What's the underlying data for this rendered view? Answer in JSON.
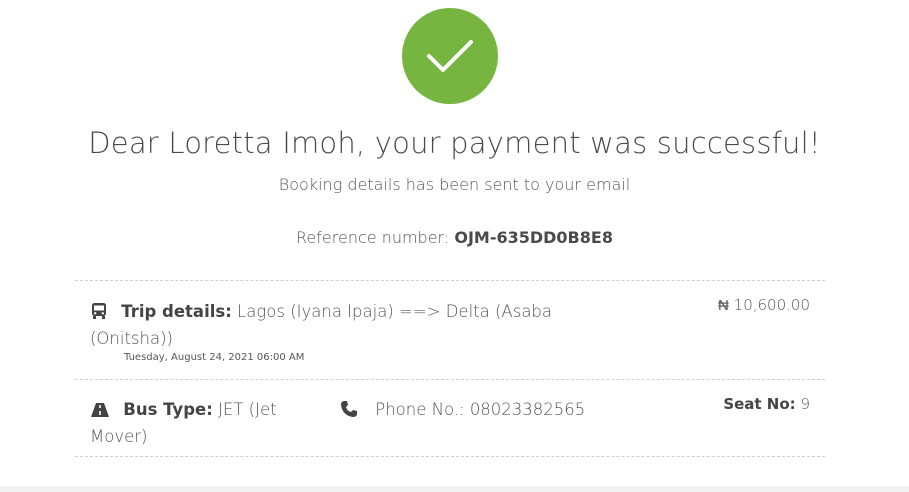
{
  "status": {
    "icon": "checkmark-icon",
    "color": "#77b541"
  },
  "headline": "Dear Loretta Imoh, your payment was successful!",
  "subline": "Booking details has been sent to your email",
  "reference": {
    "label": "Reference number:",
    "value": "OJM-635DD0B8E8"
  },
  "trip": {
    "icon": "bus-icon",
    "label": "Trip details:",
    "route": "Lagos (Iyana Ipaja) ==> Delta (Asaba (Onitsha))",
    "datetime": "Tuesday, August 24, 2021 06:00 AM",
    "price": "₦ 10,600.00"
  },
  "bus": {
    "icon": "road-icon",
    "label": "Bus Type:",
    "value": "JET (Jet Mover)"
  },
  "phone": {
    "icon": "phone-icon",
    "label": "Phone No.:",
    "value": "08023382565"
  },
  "seat": {
    "label": "Seat No:",
    "value": "9"
  }
}
